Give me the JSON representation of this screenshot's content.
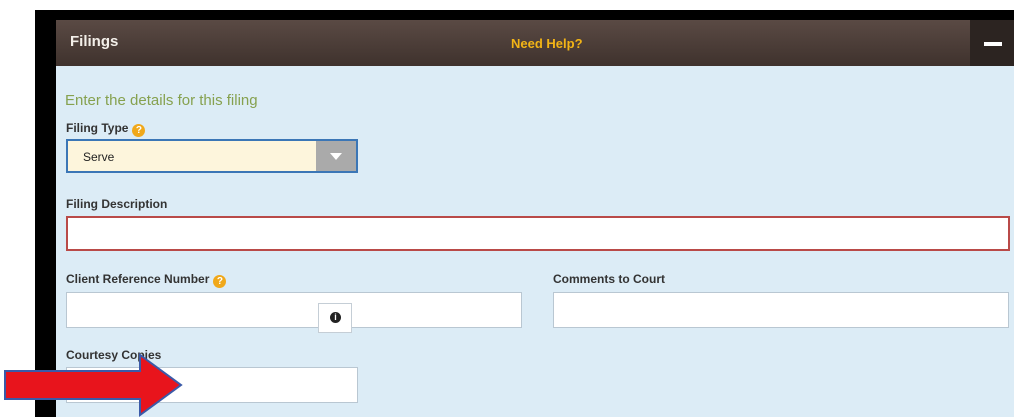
{
  "header": {
    "title": "Filings",
    "help_link": "Need Help?"
  },
  "form": {
    "intro": "Enter the details for this filing",
    "filing_type": {
      "label": "Filing Type",
      "help_icon": "?",
      "value": "Serve"
    },
    "filing_description": {
      "label": "Filing Description",
      "value": ""
    },
    "client_reference": {
      "label": "Client Reference Number",
      "help_icon": "?",
      "value": ""
    },
    "comments": {
      "label": "Comments to Court",
      "value": ""
    },
    "courtesy_copies": {
      "label": "Courtesy Copies",
      "value": "",
      "info_icon": "i"
    }
  },
  "colors": {
    "header_bg": "#4a3c37",
    "panel_bg": "#dcecf6",
    "help_link": "#f2b416",
    "error_border": "#b94a48",
    "arrow": "#e8141c"
  },
  "icons": [
    "question-icon",
    "chevron-down-icon",
    "minus-icon",
    "info-icon",
    "red-arrow-annotation"
  ]
}
